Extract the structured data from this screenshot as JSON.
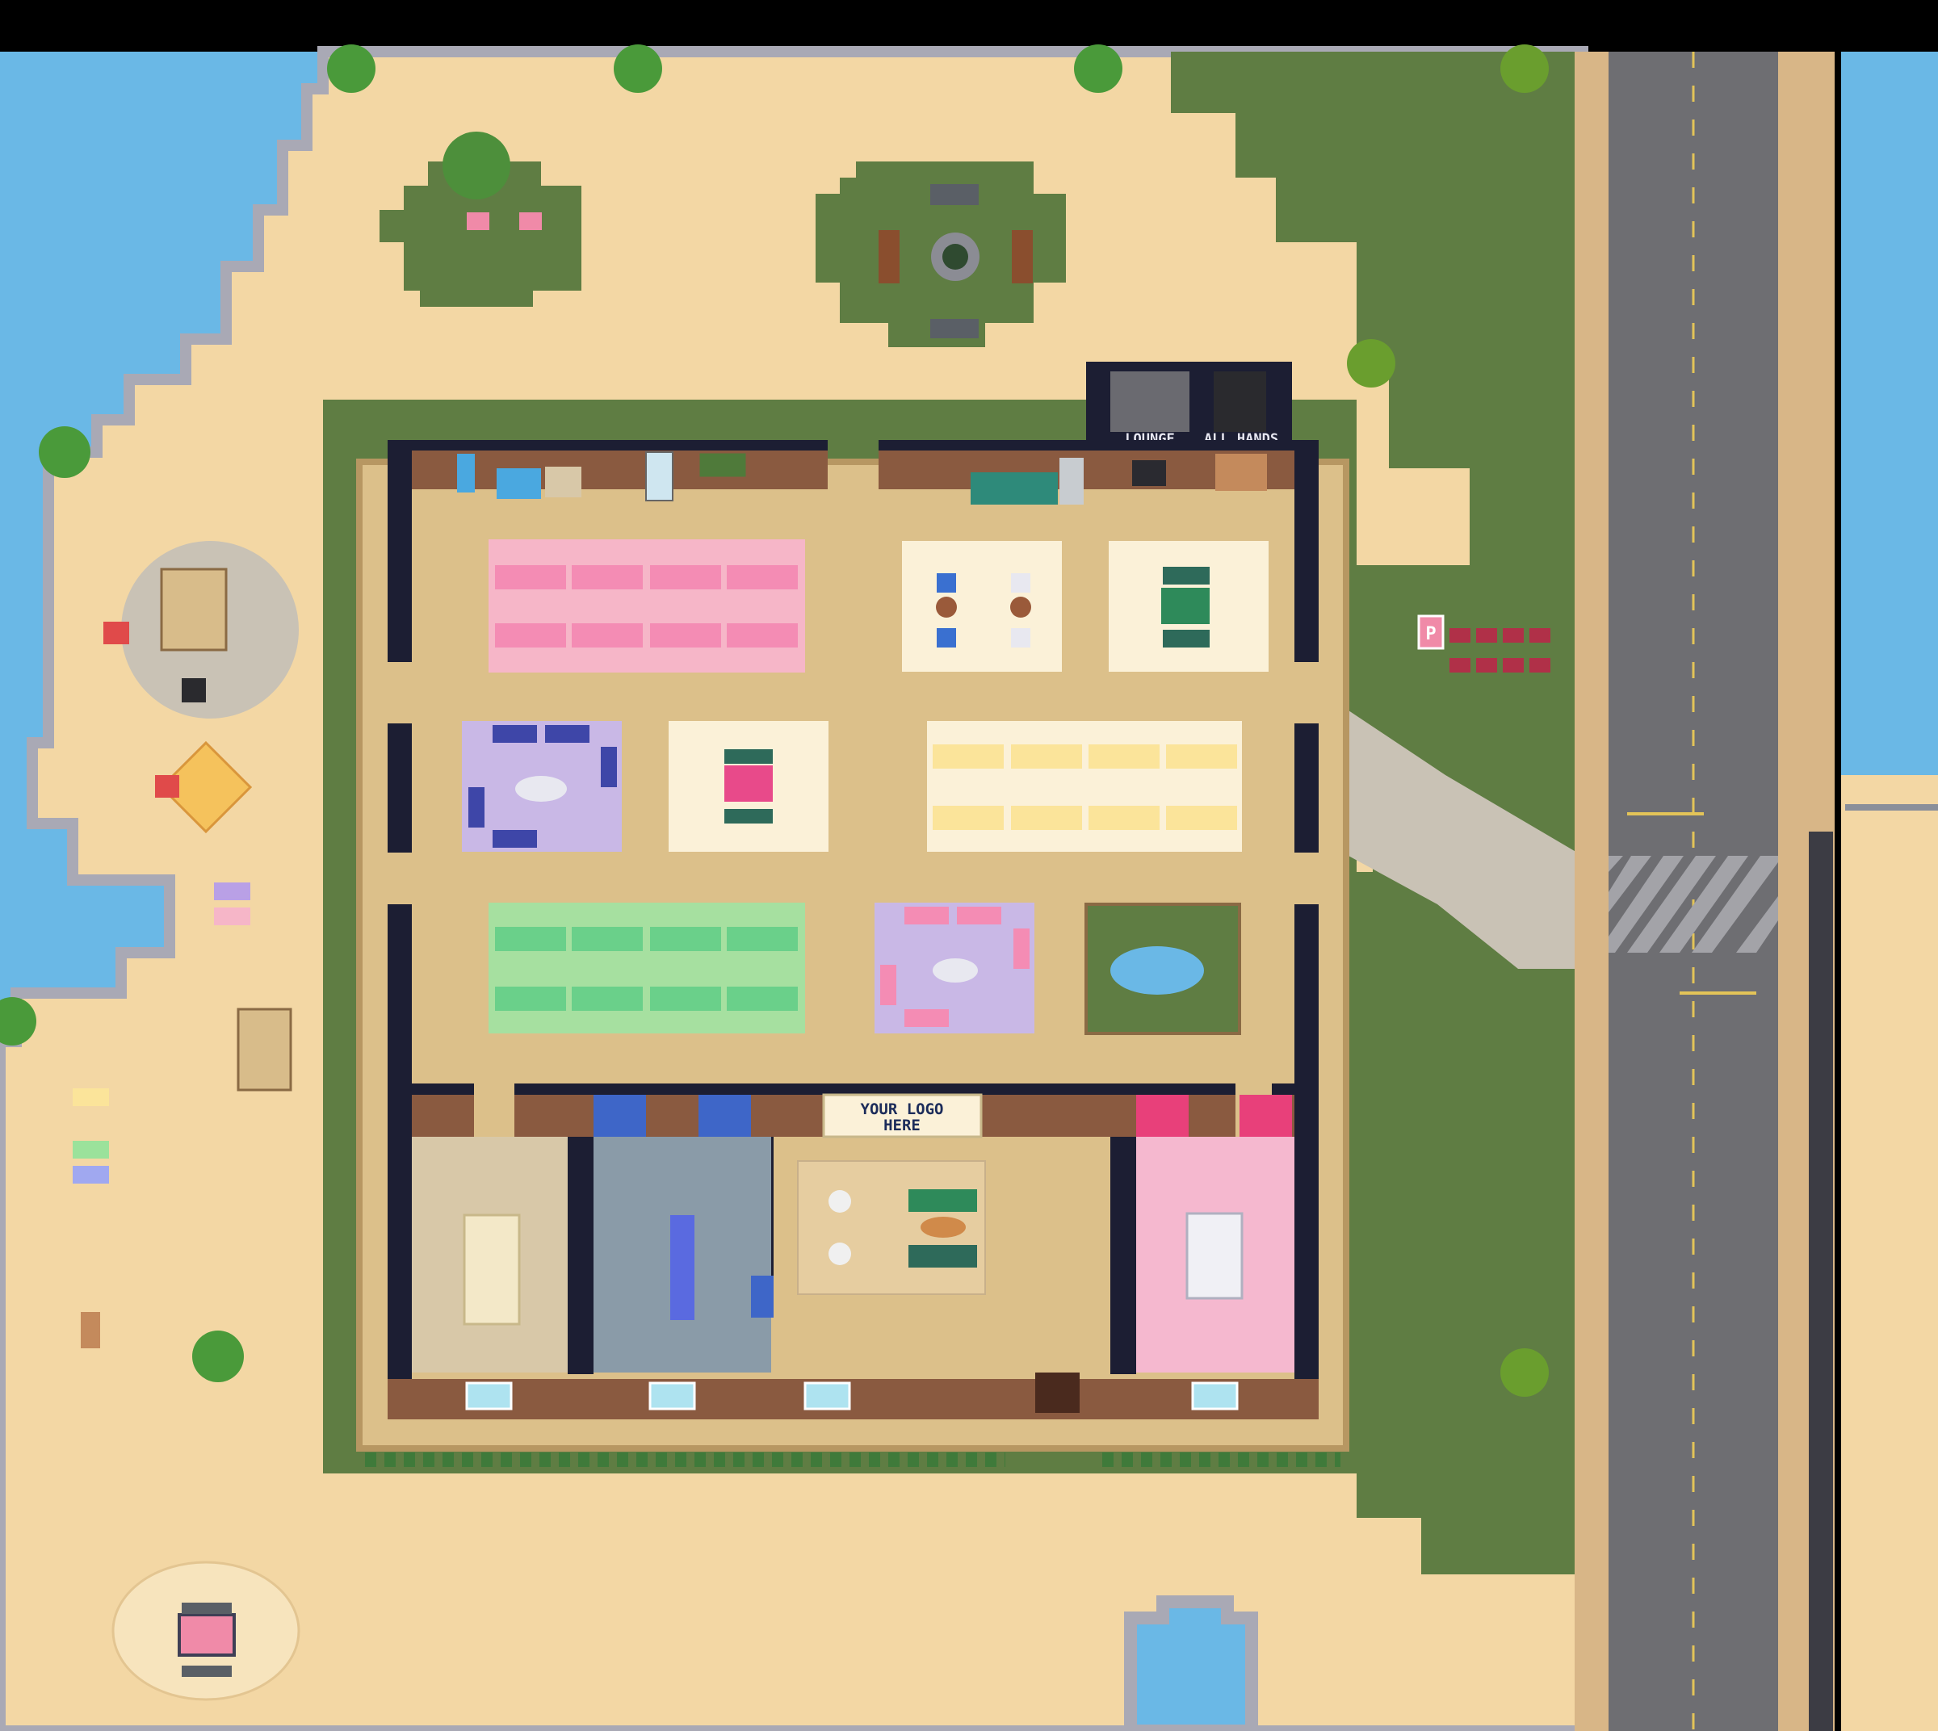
{
  "signs": {
    "lounge": "LOUNGE",
    "all_hands": "ALL HANDS",
    "logo_line1": "YOUR LOGO",
    "logo_line2": "HERE",
    "parking": "P"
  },
  "colors": {
    "ocean": "#6ab8e6",
    "sand": "#f3d7a4",
    "grass": "#5f7d43",
    "road": "#6e6e72",
    "floor": "#dcc08a",
    "wall": "#1c1e33",
    "brick": "#8a5a40",
    "rug_pink": "#f6b6c8",
    "rug_yellow": "#fbe9a8",
    "rug_green": "#a6e0a0",
    "rug_purple": "#c9b8e6",
    "rug_cream": "#fbf1d8",
    "room_pink": "#f5b8cf",
    "room_tile": "#8a9ba8"
  }
}
